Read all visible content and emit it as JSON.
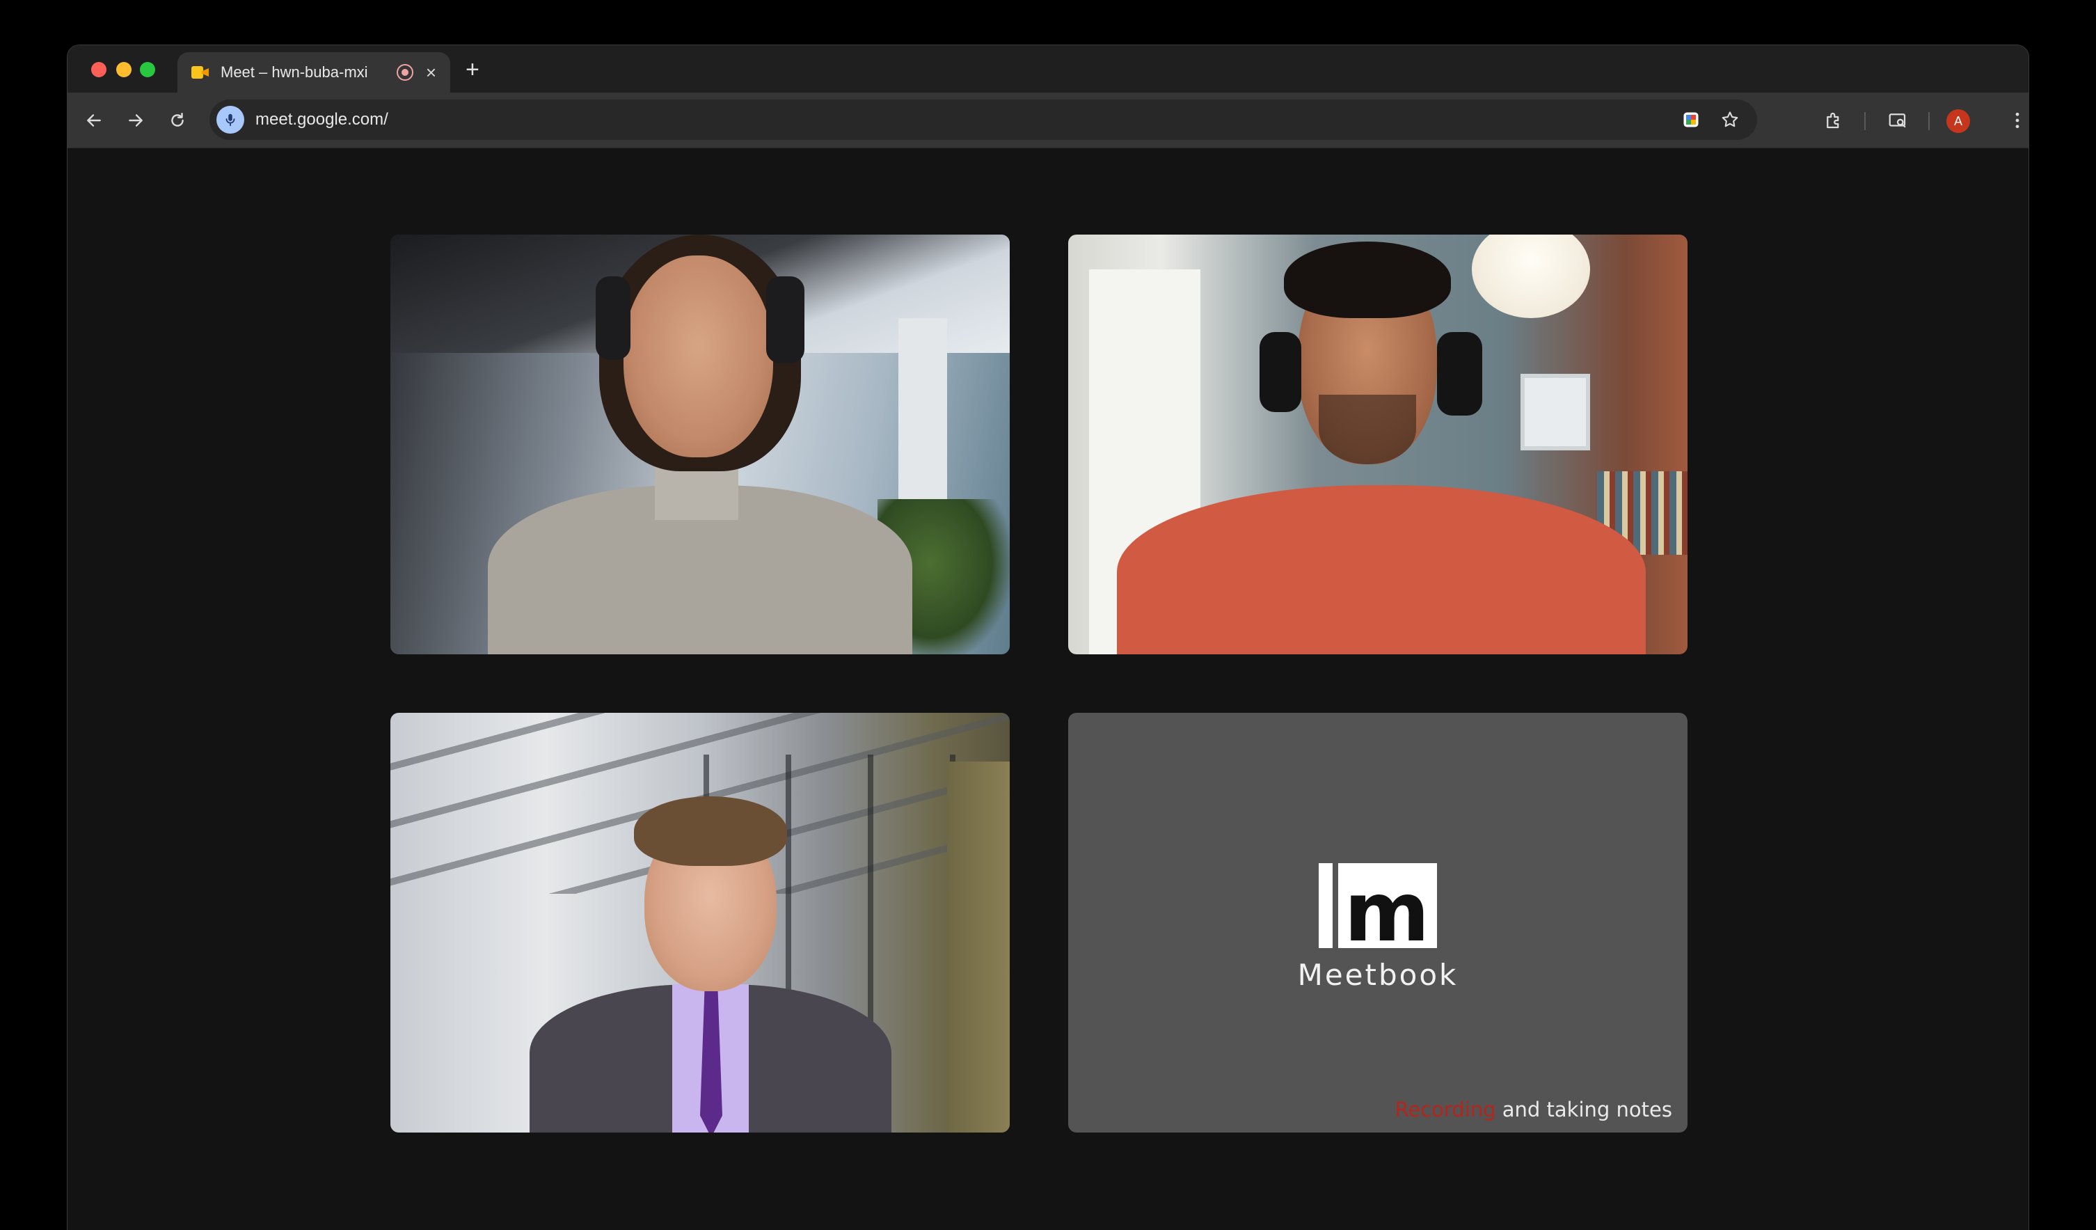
{
  "browser": {
    "tab": {
      "title": "Meet – hwn-buba-mxi",
      "favicon": "google-meet-icon",
      "recording_indicator": "record-icon",
      "close": "×"
    },
    "new_tab": "+",
    "url": "meet.google.com/"
  },
  "meeting": {
    "participants": [
      {
        "tile": "participant-woman-headphones"
      },
      {
        "tile": "participant-man-headset-red-shirt"
      },
      {
        "tile": "participant-man-suit"
      }
    ],
    "bot_tile": {
      "logo_letter": "m",
      "logo_text": "Meetbook",
      "status_recording": "Recording",
      "status_rest": " and taking notes"
    }
  },
  "colors": {
    "recording": "#b3261e",
    "bot_tile_bg": "#545454",
    "avatar": "#c5361d"
  },
  "profile": {
    "initial": "A"
  }
}
